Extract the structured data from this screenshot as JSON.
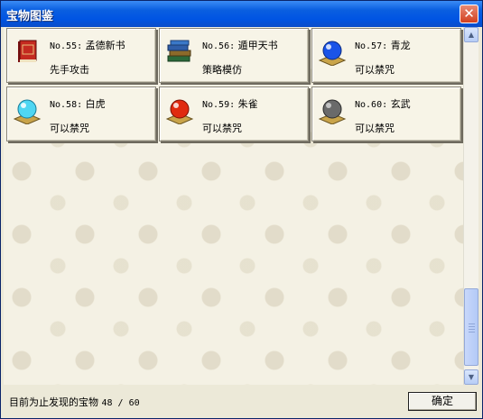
{
  "window": {
    "title": "宝物图鉴",
    "close_label": "✕"
  },
  "items": [
    {
      "no": "No.55:",
      "name": "孟德新书",
      "desc": "先手攻击",
      "icon": "red-book-icon"
    },
    {
      "no": "No.56:",
      "name": "遁甲天书",
      "desc": "策略模仿",
      "icon": "stacked-books-icon"
    },
    {
      "no": "No.57:",
      "name": "青龙",
      "desc": "可以禁咒",
      "icon": "blue-orb-icon",
      "color": "#1a54e8"
    },
    {
      "no": "No.58:",
      "name": "白虎",
      "desc": "可以禁咒",
      "icon": "cyan-orb-icon",
      "color": "#4fd6f2"
    },
    {
      "no": "No.59:",
      "name": "朱雀",
      "desc": "可以禁咒",
      "icon": "red-orb-icon",
      "color": "#e02a10"
    },
    {
      "no": "No.60:",
      "name": "玄武",
      "desc": "可以禁咒",
      "icon": "gray-orb-icon",
      "color": "#6a6a6a"
    }
  ],
  "status": {
    "text": "目前为止发现的宝物",
    "count": "48 / 60"
  },
  "ok_button": {
    "label": "确定"
  }
}
